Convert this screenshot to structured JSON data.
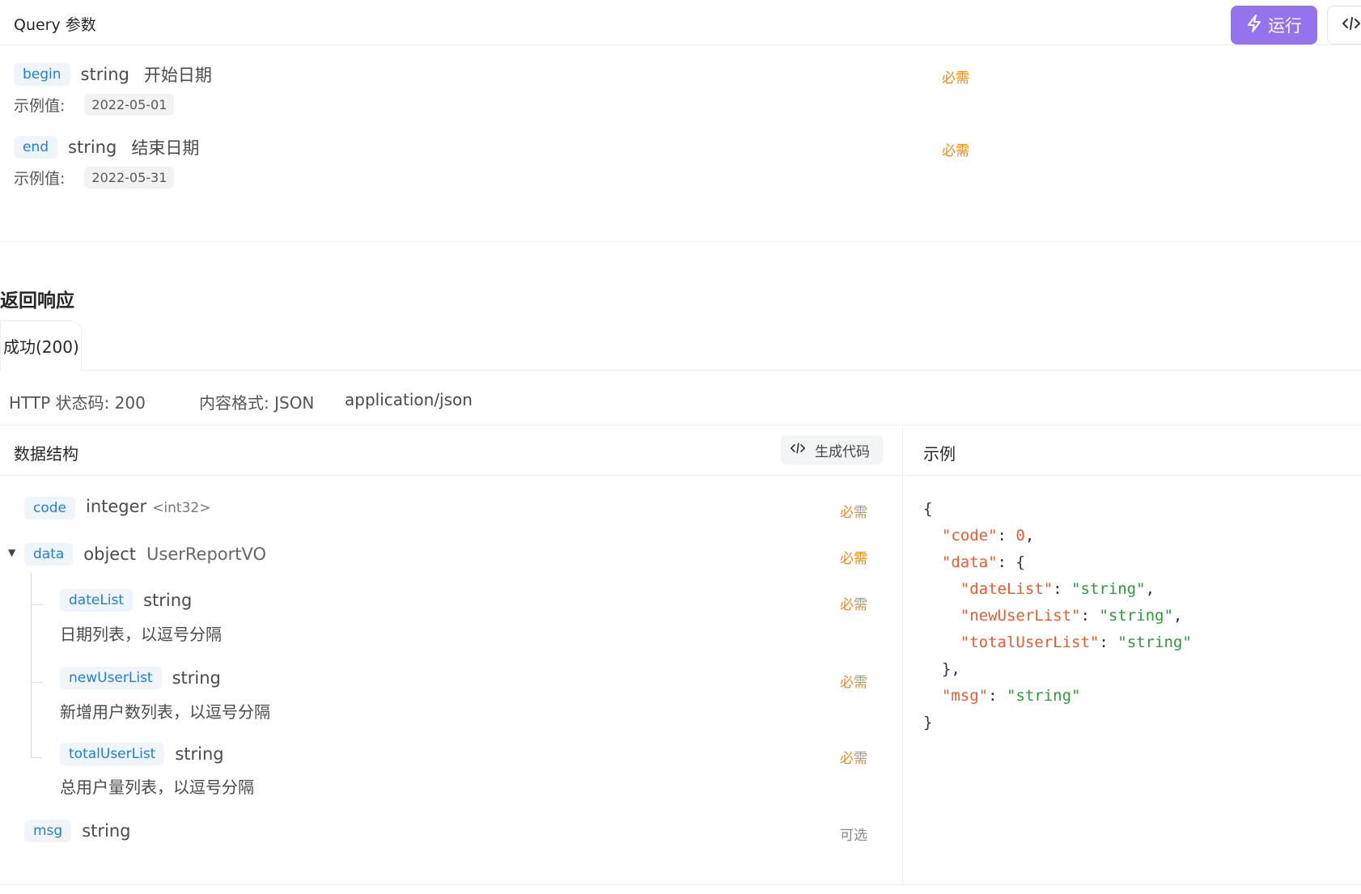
{
  "query": {
    "title": "Query 参数",
    "run_label": "运行",
    "params": [
      {
        "name": "begin",
        "type": "string",
        "desc": "开始日期",
        "required": "必需",
        "example_label": "示例值:",
        "example": "2022-05-01"
      },
      {
        "name": "end",
        "type": "string",
        "desc": "结束日期",
        "required": "必需",
        "example_label": "示例值:",
        "example": "2022-05-31"
      }
    ]
  },
  "response": {
    "title": "返回响应",
    "tab_label": "成功(200)",
    "status": "HTTP 状态码: 200",
    "format": "内容格式: JSON",
    "mime": "application/json"
  },
  "schema": {
    "title": "数据结构",
    "gen_code_label": "生成代码",
    "fields": [
      {
        "name": "code",
        "type": "integer",
        "format": "<int32>",
        "required": "必需"
      },
      {
        "name": "data",
        "type": "object",
        "ref": "UserReportVO",
        "required": "必需"
      },
      {
        "name": "dateList",
        "type": "string",
        "desc": "日期列表，以逗号分隔",
        "required": "必需"
      },
      {
        "name": "newUserList",
        "type": "string",
        "desc": "新增用户数列表，以逗号分隔",
        "required": "必需"
      },
      {
        "name": "totalUserList",
        "type": "string",
        "desc": "总用户量列表，以逗号分隔",
        "required": "必需"
      },
      {
        "name": "msg",
        "type": "string",
        "required": "可选"
      }
    ]
  },
  "example": {
    "title": "示例",
    "lines": [
      "{",
      "  \"code\": 0,",
      "  \"data\": {",
      "    \"dateList\": \"string\",",
      "    \"newUserList\": \"string\",",
      "    \"totalUserList\": \"string\"",
      "  },",
      "  \"msg\": \"string\"",
      "}"
    ]
  },
  "colors": {
    "accent": "#9373ee",
    "param_name": "#1f7fd6",
    "required": "#ec8a1b",
    "json_key": "#e65d2f",
    "json_string": "#2d9a3e"
  },
  "icons": [
    "lightning-icon",
    "code-icon",
    "caret-down-icon"
  ]
}
